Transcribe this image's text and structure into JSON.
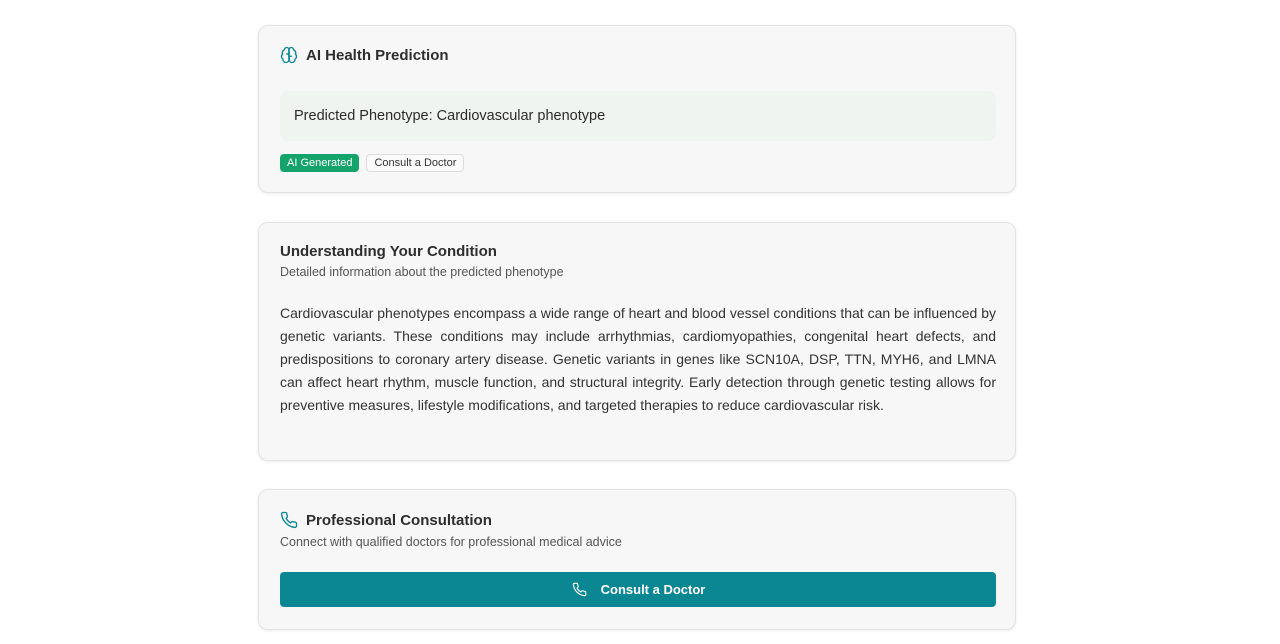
{
  "prediction": {
    "title": "AI Health Prediction",
    "icon": "brain-icon",
    "phenotype_text": "Predicted Phenotype: Cardiovascular phenotype",
    "badges": {
      "ai_generated": "AI Generated",
      "consult": "Consult a Doctor"
    },
    "colors": {
      "badge_green": "#14a36a",
      "icon_teal": "#0b8793",
      "phenotype_bg": "#eff4f1"
    }
  },
  "understanding": {
    "title": "Understanding Your Condition",
    "subtitle": "Detailed information about the predicted phenotype",
    "description": "Cardiovascular phenotypes encompass a wide range of heart and blood vessel conditions that can be influenced by genetic variants. These conditions may include arrhythmias, cardiomyopathies, congenital heart defects, and predispositions to coronary artery disease. Genetic variants in genes like SCN10A, DSP, TTN, MYH6, and LMNA can affect heart rhythm, muscle function, and structural integrity. Early detection through genetic testing allows for preventive measures, lifestyle modifications, and targeted therapies to reduce cardiovascular risk."
  },
  "consultation": {
    "title": "Professional Consultation",
    "icon": "phone-icon",
    "subtitle": "Connect with qualified doctors for professional medical advice",
    "button_label": "Consult a Doctor",
    "colors": {
      "button_bg": "#0b8793"
    }
  }
}
